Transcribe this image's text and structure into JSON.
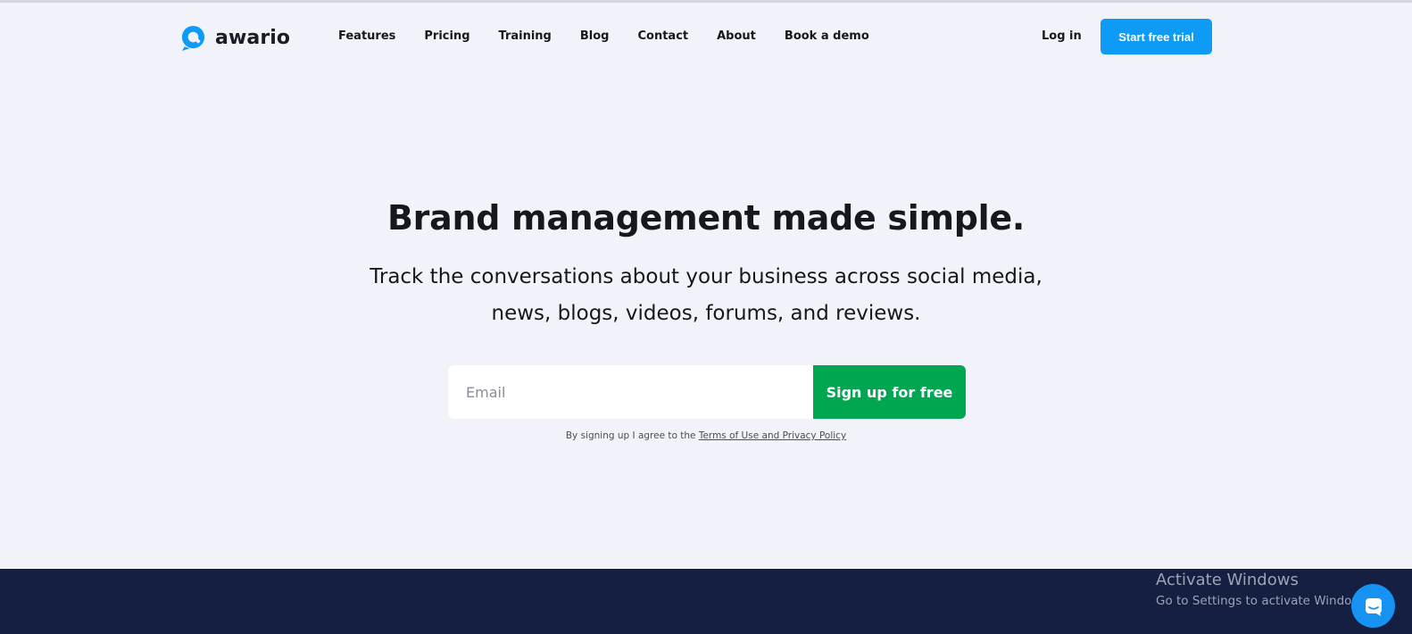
{
  "brand": {
    "name": "awario",
    "accent": "#0d9bf5",
    "icon": "awario-logo-icon"
  },
  "nav": {
    "items": [
      {
        "label": "Features"
      },
      {
        "label": "Pricing"
      },
      {
        "label": "Training"
      },
      {
        "label": "Blog"
      },
      {
        "label": "Contact"
      },
      {
        "label": "About"
      },
      {
        "label": "Book a demo"
      }
    ],
    "login_label": "Log in",
    "cta_label": "Start free trial"
  },
  "hero": {
    "title": "Brand management made simple.",
    "subtitle_line1": "Track the conversations about your business across social media,",
    "subtitle_line2": "news, blogs, videos, forums, and reviews."
  },
  "signup": {
    "email_placeholder": "Email",
    "button_label": "Sign up for free",
    "button_color": "#01a651",
    "terms_prefix": "By signing up I agree to the ",
    "terms_link": "Terms of Use and Privacy Policy"
  },
  "overlay": {
    "activate_title": "Activate Windows",
    "activate_sub": "Go to Settings to activate Windows.",
    "chat_icon": "chat-icon"
  },
  "colors": {
    "background": "#f2f3fa",
    "footer_band": "#141f42"
  }
}
